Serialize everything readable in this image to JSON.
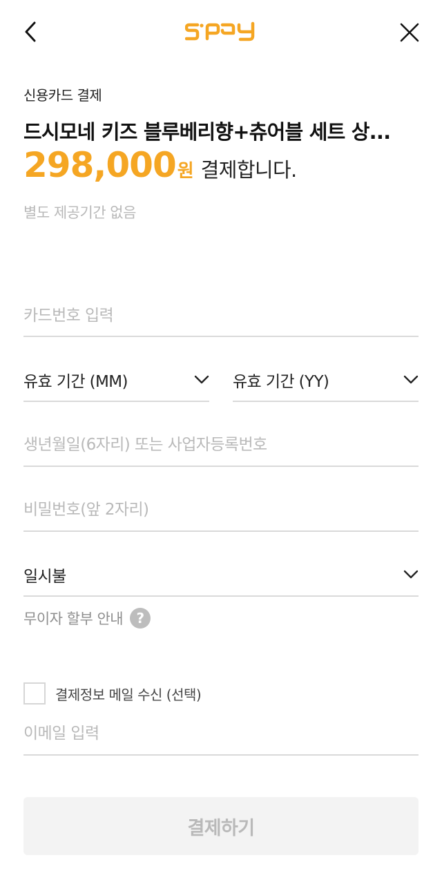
{
  "header": {
    "back_icon": "chevron-left-icon",
    "logo_icon": "spay-logo-icon",
    "close_icon": "close-icon"
  },
  "colors": {
    "accent": "#f5a623",
    "placeholder": "#b9b9b9",
    "divider": "#d9d9d9",
    "button_bg": "#f3f3f3"
  },
  "payment": {
    "method_label": "신용카드 결제",
    "product_name": "드시모네 키즈 블루베리향+츄어블 세트 상...",
    "amount": "298,000",
    "currency": "원",
    "amount_suffix": "결제합니다.",
    "notice": "별도 제공기간 없음"
  },
  "form": {
    "card_number_placeholder": "카드번호 입력",
    "expiry_month_label": "유효 기간 (MM)",
    "expiry_year_label": "유효 기간 (YY)",
    "birth_placeholder": "생년월일(6자리) 또는 사업자등록번호",
    "password_placeholder": "비밀번호(앞 2자리)",
    "installment_label": "일시불",
    "installment_info": "무이자 할부 안내",
    "help_glyph": "?",
    "email_opt_label": "결제정보 메일 수신 (선택)",
    "email_placeholder": "이메일 입력"
  },
  "submit": {
    "label": "결제하기"
  }
}
